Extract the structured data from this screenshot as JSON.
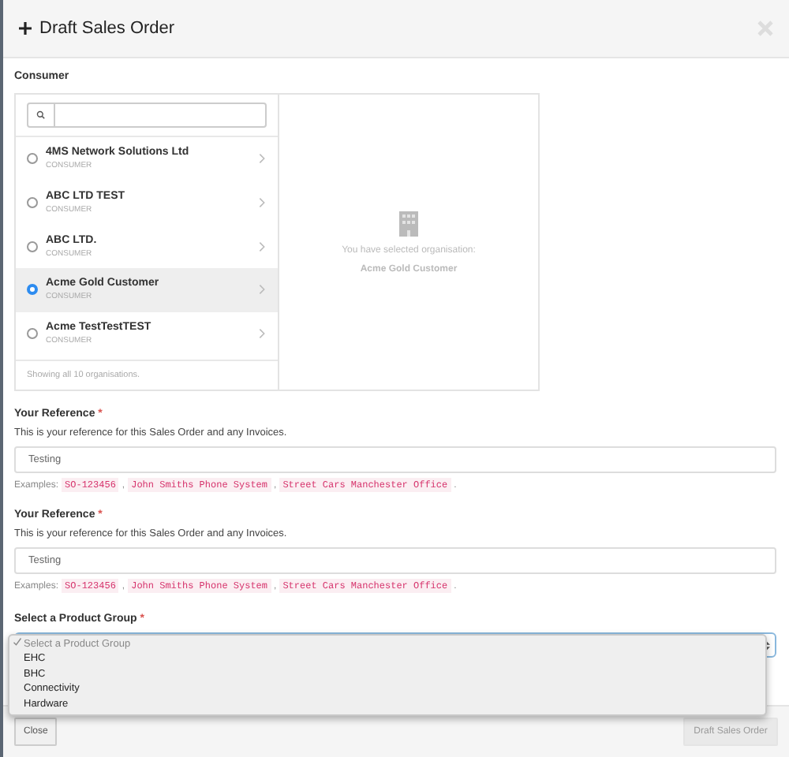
{
  "window": {
    "title": "Draft Sales Order"
  },
  "consumer": {
    "label": "Consumer",
    "organisations": [
      {
        "name": "4MS Network Solutions Ltd",
        "type": "CONSUMER",
        "selected": false
      },
      {
        "name": "ABC LTD TEST",
        "type": "CONSUMER",
        "selected": false
      },
      {
        "name": "ABC LTD.",
        "type": "CONSUMER",
        "selected": false
      },
      {
        "name": "Acme Gold Customer",
        "type": "CONSUMER",
        "selected": true
      },
      {
        "name": "Acme TestTestTEST",
        "type": "CONSUMER",
        "selected": false
      }
    ],
    "list_footer": "Showing all 10 organisations.",
    "selection_text": "You have selected organisation:",
    "selection_name": "Acme Gold Customer"
  },
  "references": [
    {
      "label": "Your Reference",
      "required": "*",
      "help": "This is your reference for this Sales Order and any Invoices.",
      "value": "Testing",
      "examples_label": "Examples:",
      "examples": [
        {
          "code": "SO-123456",
          "after": ","
        },
        {
          "code": "John Smiths Phone System",
          "after": ","
        },
        {
          "code": "Street Cars Manchester Office",
          "after": "."
        }
      ]
    },
    {
      "label": "Your Reference",
      "required": "*",
      "help": "This is your reference for this Sales Order and any Invoices.",
      "value": "Testing",
      "examples_label": "Examples:",
      "examples": [
        {
          "code": "SO-123456",
          "after": ","
        },
        {
          "code": "John Smiths Phone System",
          "after": ","
        },
        {
          "code": "Street Cars Manchester Office",
          "after": "."
        }
      ]
    }
  ],
  "product_group": {
    "label": "Select a Product Group",
    "required": "*",
    "options": [
      {
        "label": "Select a Product Group",
        "selected": true
      },
      {
        "label": "EHC",
        "selected": false
      },
      {
        "label": "BHC",
        "selected": false
      },
      {
        "label": "Connectivity",
        "selected": false
      },
      {
        "label": "Hardware",
        "selected": false
      }
    ]
  },
  "footer": {
    "buttons": [
      {
        "label": "Close",
        "disabled": false
      },
      {
        "label": "Draft Sales Order",
        "disabled": true
      }
    ]
  }
}
